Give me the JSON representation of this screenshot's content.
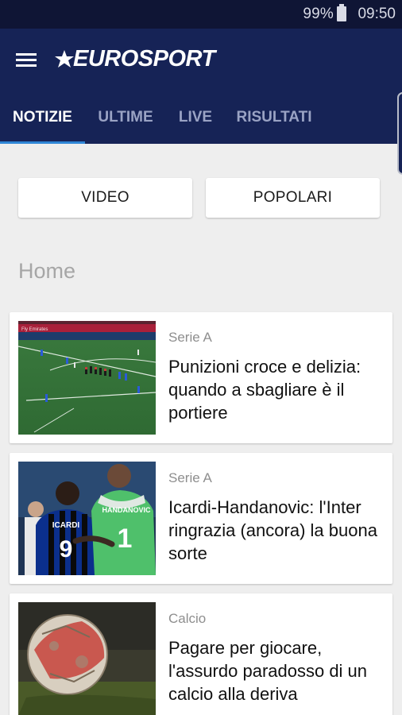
{
  "status_bar": {
    "battery": "99%",
    "time": "09:50"
  },
  "app": {
    "brand": "EUROSPORT"
  },
  "tabs": [
    {
      "label": "NOTIZIE"
    },
    {
      "label": "ULTIME"
    },
    {
      "label": "LIVE"
    },
    {
      "label": "RISULTATI"
    }
  ],
  "buttons": {
    "video": "VIDEO",
    "popular": "POPOLARI"
  },
  "section": {
    "title": "Home"
  },
  "articles": [
    {
      "category": "Serie A",
      "title": "Punizioni croce e delizia: quando a sbagliare è il portiere"
    },
    {
      "category": "Serie A",
      "title": "Icardi-Handanovic: l'Inter ringrazia (ancora) la buona sorte"
    },
    {
      "category": "Calcio",
      "title": "Pagare per giocare, l'assurdo paradosso di un calcio alla deriva"
    }
  ],
  "thumbnails": [
    {
      "board_text": "Fly Emirates"
    },
    {
      "jersey_left": "ICARDI",
      "number_left": "9",
      "jersey_right": "HANDANOVIC",
      "number_right": "1"
    },
    {}
  ],
  "colors": {
    "status_bar": "#0f1535",
    "app_bar": "#162356",
    "tab_indicator": "#2f86d6",
    "background": "#eeeeee"
  }
}
